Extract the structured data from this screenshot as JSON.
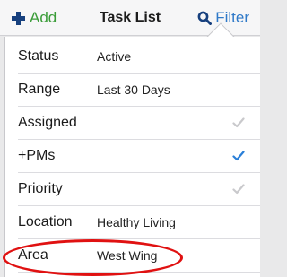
{
  "nav": {
    "add_label": "Add",
    "title": "Task List",
    "filter_label": "Filter"
  },
  "filters": [
    {
      "label": "Status",
      "value": "Active",
      "checked": null
    },
    {
      "label": "Range",
      "value": "Last 30 Days",
      "checked": null
    },
    {
      "label": "Assigned",
      "value": "",
      "checked": false
    },
    {
      "label": "+PMs",
      "value": "",
      "checked": true
    },
    {
      "label": "Priority",
      "value": "",
      "checked": false
    },
    {
      "label": "Location",
      "value": "Healthy Living",
      "checked": null
    },
    {
      "label": "Area",
      "value": "West Wing",
      "checked": null
    }
  ],
  "colors": {
    "add_green": "#3a9c38",
    "plus_blue": "#17407e",
    "filter_blue": "#2f79c8",
    "check_active": "#2a7fd8",
    "check_inactive": "#c9c9cc",
    "highlight_red": "#e01111"
  }
}
